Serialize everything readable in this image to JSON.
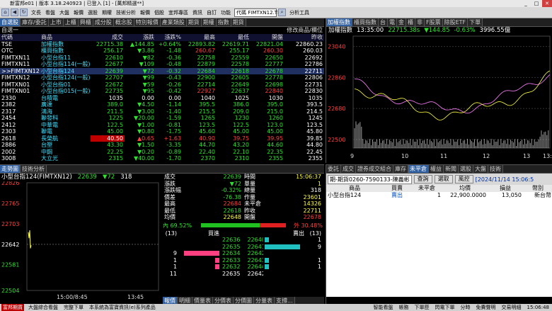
{
  "window": {
    "title": "新富邦e01 | 版本 3.18.240923 | 已登入 [1] - [萬邦精選**]"
  },
  "toolbar": {
    "items": [
      "文長",
      "看盤",
      "大盤",
      "報價",
      "選股",
      "期權",
      "技術分析",
      "報價",
      "個股",
      "宜邦專區",
      "資訊",
      "自訂",
      "功能"
    ],
    "code": "代碼 FIMTXN12.TF",
    "analysis": "分析工具"
  },
  "top_tabs": [
    "自選股",
    "庫存/委託",
    "上市",
    "上櫃",
    "興櫃",
    "成分股",
    "概念股",
    "特別報價",
    "產業類股",
    "期貨",
    "期權",
    "指數",
    "期貨"
  ],
  "quote_header": {
    "group": "自選一",
    "edit": "修改商品/欄位",
    "cols": [
      "代碼",
      "商品",
      "成交",
      "漲跌",
      "漲跌%",
      "最高",
      "最低",
      "開盤",
      "昨收"
    ]
  },
  "quotes": [
    {
      "code": "TSE",
      "name": "加權指數",
      "price": "22715.38",
      "chg": "▲144.85",
      "pct": "+0.64%",
      "high": "22893.82",
      "low": "22619.71",
      "open": "22821.04",
      "prev": "22860.23",
      "c": "g"
    },
    {
      "code": "OTC",
      "name": "櫃買指數",
      "price": "256.17",
      "chg": "▼3.86",
      "pct": "-1.48",
      "high": "260.67",
      "low": "255.17",
      "open": "260.30",
      "prev": "260.03",
      "c": "g"
    },
    {
      "code": "FIMTXN11",
      "name": "小型台指11",
      "price": "22610",
      "chg": "▼82",
      "pct": "-0.36",
      "high": "22758",
      "low": "22559",
      "open": "22650",
      "prev": "22692",
      "c": "g"
    },
    {
      "code": "FIMTXN11",
      "name": "小型台指114(一般)",
      "price": "22677",
      "chg": "▼109",
      "pct": "-0.48",
      "high": "22879",
      "low": "22578",
      "open": "22777",
      "prev": "22786",
      "c": "g"
    },
    {
      "code": ">>FIMTXN12",
      "name": "小型台指124",
      "price": "22639",
      "chg": "▼72",
      "pct": "-0.32",
      "high": "22684",
      "low": "22618",
      "open": "22678",
      "prev": "22711",
      "c": "g"
    },
    {
      "code": "FIMTXN12",
      "name": "小型台指124(一般)",
      "price": "22707",
      "chg": "▼99",
      "pct": "-0.43",
      "high": "22900",
      "low": "22605",
      "open": "22778",
      "prev": "22806",
      "c": "g"
    },
    {
      "code": "FIMTXN01",
      "name": "小型台指01",
      "price": "22672",
      "chg": "▼59",
      "pct": "-0.26",
      "high": "22714",
      "low": "22649",
      "open": "22698",
      "prev": "22731",
      "c": "g"
    },
    {
      "code": "FIMTXN01",
      "name": "小型台指015(一般)",
      "price": "22735",
      "chg": "▼95",
      "pct": "-0.42",
      "high": "22927",
      "low": "22637",
      "open": "22840",
      "prev": "22830",
      "c": "g"
    },
    {
      "code": "2330",
      "name": "台積電",
      "price": "1035",
      "chg": "0.00",
      "pct": "0.00",
      "high": "1040",
      "low": "1025",
      "open": "1030",
      "prev": "1035",
      "c": "w"
    },
    {
      "code": "2382",
      "name": "廣達",
      "price": "389.0",
      "chg": "▼4.50",
      "pct": "-1.14",
      "high": "395.5",
      "low": "386.0",
      "open": "395.0",
      "prev": "393.5",
      "c": "g"
    },
    {
      "code": "2317",
      "name": "鴻海",
      "price": "211.5",
      "chg": "▼3.00",
      "pct": "-1.40",
      "high": "215.5",
      "low": "209.0",
      "open": "215.0",
      "prev": "214.5",
      "c": "g"
    },
    {
      "code": "2454",
      "name": "聯發科",
      "price": "1225",
      "chg": "▼20.00",
      "pct": "-1.59",
      "high": "1265",
      "low": "1230",
      "open": "1260",
      "prev": "1245",
      "c": "g"
    },
    {
      "code": "2412",
      "name": "中華電",
      "price": "122.5",
      "chg": "▼1.00",
      "pct": "-0.81",
      "high": "123.5",
      "low": "122.5",
      "open": "123.0",
      "prev": "123.5",
      "c": "g"
    },
    {
      "code": "2303",
      "name": "聯電",
      "price": "45.00",
      "chg": "▼0.80",
      "pct": "-1.75",
      "high": "45.60",
      "low": "45.00",
      "open": "45.00",
      "prev": "45.80",
      "c": "g"
    },
    {
      "code": "2618",
      "name": "長榮航",
      "price": "40.50",
      "chg": "▲0.65",
      "pct": "+1.63",
      "high": "40.90",
      "low": "39.75",
      "open": "39.95",
      "prev": "39.85",
      "c": "r"
    },
    {
      "code": "2886",
      "name": "台塑",
      "price": "43.30",
      "chg": "▼1.50",
      "pct": "-3.35",
      "high": "44.70",
      "low": "43.20",
      "open": "44.60",
      "prev": "44.80",
      "c": "g"
    },
    {
      "code": "2002",
      "name": "中鋼",
      "price": "22.25",
      "chg": "▼0.20",
      "pct": "-0.89",
      "high": "22.40",
      "low": "22.10",
      "open": "22.35",
      "prev": "22.45",
      "c": "g"
    },
    {
      "code": "3008",
      "name": "大立光",
      "price": "2315",
      "chg": "▼40.00",
      "pct": "-1.70",
      "high": "2370",
      "low": "2310",
      "open": "2355",
      "prev": "2355",
      "c": "g"
    }
  ],
  "index_tabs": [
    "加權指數",
    "櫃買指數",
    "台",
    "電",
    "金",
    "櫃",
    "非",
    "F股票",
    "除股ETF",
    "下單"
  ],
  "index_header": {
    "name": "加權指數",
    "time": "13:35:00",
    "price": "22715.38s",
    "chg": "▼144.85",
    "pct": "-0.63%",
    "vol": "3996.55億"
  },
  "index_chart": {
    "y_ticks": [
      "23040",
      "22860",
      "22680",
      "22500"
    ],
    "x_ticks": [
      "9",
      "10",
      "11",
      "12",
      "13",
      "13:30"
    ]
  },
  "detail_tabs": [
    "走勢圖",
    "技術分析"
  ],
  "detail": {
    "name": "小型台指124(FIMTXN12)",
    "price": "22639",
    "chg": "▼72",
    "vol": "318"
  },
  "mini_chart": {
    "y_ticks": [
      "22826",
      "22765",
      "22703",
      "22642",
      "22581",
      "22504"
    ],
    "x_ticks": [
      "15:00/8:45",
      "13:45"
    ]
  },
  "info": [
    {
      "k": "成交",
      "v": "22639",
      "k2": "時間",
      "v2": "15:06:37"
    },
    {
      "k": "漲跌",
      "v": "▼72",
      "k2": "單量",
      "v2": "1"
    },
    {
      "k": "漲跌幅",
      "v": "-0.32%",
      "k2": "總量",
      "v2": "318"
    },
    {
      "k": "價差",
      "v": "-76.38",
      "k2": "作量",
      "v2": "23601"
    },
    {
      "k": "最高",
      "v": "22684",
      "k2": "未平倉",
      "v2": "14326"
    },
    {
      "k": "最低",
      "v": "22618",
      "k2": "昨收",
      "v2": "22711"
    },
    {
      "k": "均價",
      "v": "22648",
      "k2": "開盤",
      "v2": "22678"
    }
  ],
  "ratio": {
    "inner": "內 69.52%",
    "outer": "外 30.48%",
    "inner_pct": 69.52
  },
  "book_header": {
    "qty": "(13)",
    "buy": "買進",
    "sell": "賣出",
    "qty2": "(13)"
  },
  "book": [
    {
      "bq": "",
      "bp": "22636",
      "ap": "22640",
      "aq": "1",
      "bw": 0,
      "aw": 0.1
    },
    {
      "bq": "",
      "bp": "22635",
      "ap": "22641",
      "aq": "9",
      "bw": 0,
      "aw": 0.9
    },
    {
      "bq": "9",
      "bp": "22634",
      "ap": "22642",
      "aq": "",
      "bw": 0.9,
      "aw": 0
    },
    {
      "bq": "1",
      "bp": "22633",
      "ap": "22643",
      "aq": "1",
      "bw": 0.1,
      "aw": 0.1
    },
    {
      "bq": "1",
      "bp": "22632",
      "ap": "22644",
      "aq": "1",
      "bw": 0.1,
      "aw": 0.1
    },
    {
      "bq": "11",
      "bp": "22635",
      "ap": "22642",
      "aq": "",
      "bw": 0,
      "aw": 0
    }
  ],
  "bottom_tabs": [
    "報價",
    "明細",
    "價量表",
    "分價表",
    "分價圖",
    "分量表",
    "支撐..."
  ],
  "order_tabs": [
    "委託",
    "成交",
    "證券成交組合",
    "庫存",
    "未平倉",
    "權益",
    "新聞",
    "選股",
    "大盤",
    "技術"
  ],
  "order_bar": {
    "account": "期-期貨0260-7590133-陳義彬",
    "query": "查詢",
    "options": "選取",
    "settings": "風控",
    "date": "[2024/11/14 15:06:5"
  },
  "order_header": [
    "商品",
    "買賣",
    "未平倉",
    "均價",
    "損益",
    "幣別"
  ],
  "orders": [
    {
      "item": "小型台指124",
      "side": "賣出",
      "qty": "1",
      "avg": "22,900.0000",
      "pnl": "13,050",
      "cur": "新台幣"
    }
  ],
  "status": {
    "left": "富邦期貨",
    "msg": "大盤綜合看盤",
    "tip": "完整下單",
    "note": "本系統為富寶資訊(e)系列產品",
    "right": [
      "智能看盤",
      "帳務",
      "下單匣",
      "閃電下單",
      "分時",
      "免費聲明",
      "交易明細",
      "15:06:48"
    ]
  }
}
